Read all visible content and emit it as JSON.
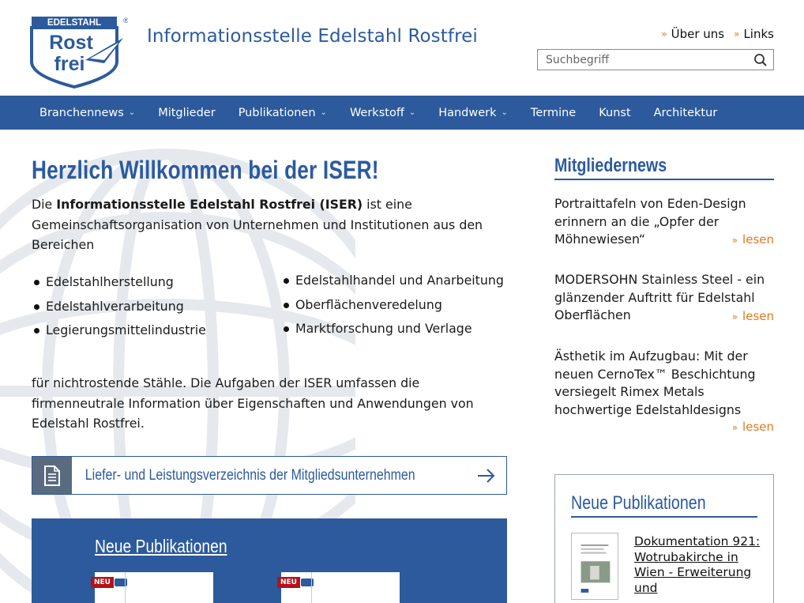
{
  "header": {
    "logo_text_top": "EDELSTAHL",
    "logo_text_rost": "Rost",
    "logo_text_frei": "frei",
    "logo_registered": "®",
    "site_title": "Informationsstelle Edelstahl Rostfrei",
    "toplinks": [
      {
        "label": "Über uns"
      },
      {
        "label": "Links"
      }
    ],
    "search": {
      "placeholder": "Suchbegriff",
      "value": ""
    }
  },
  "nav": {
    "items": [
      {
        "label": "Branchennews",
        "dropdown": true
      },
      {
        "label": "Mitglieder",
        "dropdown": false
      },
      {
        "label": "Publikationen",
        "dropdown": true
      },
      {
        "label": "Werkstoff",
        "dropdown": true
      },
      {
        "label": "Handwerk",
        "dropdown": true
      },
      {
        "label": "Termine",
        "dropdown": false
      },
      {
        "label": "Kunst",
        "dropdown": false
      },
      {
        "label": "Architektur",
        "dropdown": false
      }
    ]
  },
  "main": {
    "welcome_title": "Herzlich Willkommen bei der ISER!",
    "intro_prefix": "Die ",
    "intro_bold": "Informationsstelle Edelstahl Rostfrei (ISER)",
    "intro_suffix": " ist eine Gemeinschaftsorganisation von Unternehmen und Institutionen aus den Bereichen",
    "list_col1": [
      "Edelstahlherstellung",
      "Edelstahlverarbeitung",
      "Legierungsmittelindustrie"
    ],
    "list_col2": [
      "Edelstahlhandel und Anarbeitung",
      "Oberflächenveredelung",
      "Marktforschung und Verlage"
    ],
    "outro": "für nichtrostende Stähle. Die Aufgaben der ISER umfassen die firmenneutrale Information über Eigenschaften und Anwendungen von Edelstahl Rostfrei.",
    "directory_link": "Liefer- und Leistungsverzeichnis der Mitgliedsunternehmen",
    "pubs_title": "Neue Publikationen",
    "pub_badge": "NEU"
  },
  "sidebar": {
    "news_title": "Mitgliedernews",
    "read_label": "lesen",
    "news": [
      {
        "text": "Portraittafeln von Eden-Design erinnern an die „Opfer der Möhnewiesen“"
      },
      {
        "text": "MODERSOHN Stainless Steel - ein glänzender Auftritt für Edelstahl Oberflächen"
      },
      {
        "text": "Ästhetik im Aufzugbau: Mit der neuen CernoTex™ Beschichtung versiegelt Rimex Metals hochwertige Edelstahldesigns"
      }
    ],
    "pubs_title": "Neue Publikationen",
    "pub_link": "Dokumentation 921: Wotrubakirche in Wien - Erweiterung und"
  },
  "colors": {
    "brand_blue": "#2c5a9c",
    "accent_orange": "#e07a1f",
    "badge_red": "#b3121a"
  }
}
